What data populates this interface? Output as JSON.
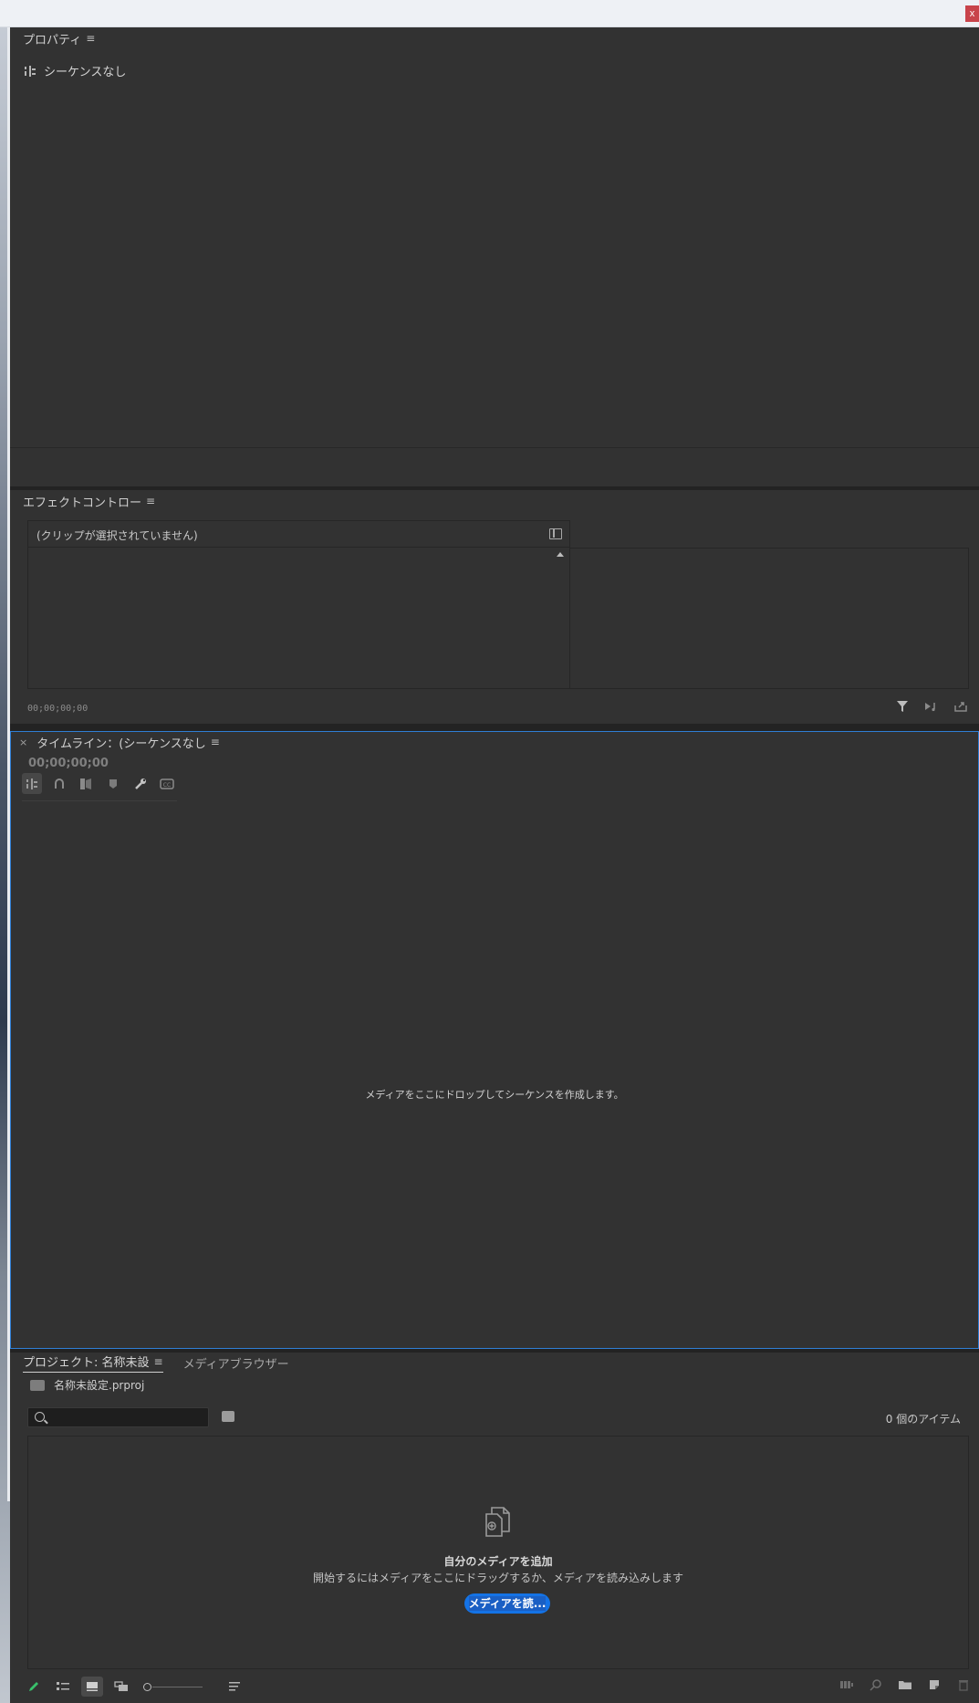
{
  "window": {
    "close_label": "x"
  },
  "properties": {
    "title": "プロパティ",
    "menu_glyph": "≡",
    "sequence_label": "シーケンスなし"
  },
  "effect_controls": {
    "title": "エフェクトコントロー",
    "menu_glyph": "≡",
    "clip_label": "(クリップが選択されていません)",
    "timecode": "00;00;00;00"
  },
  "timeline": {
    "close_glyph": "×",
    "title": "タイムライン：(シーケンスなし",
    "menu_glyph": "≡",
    "timecode": "00;00;00;00",
    "drop_message": "メディアをここにドロップしてシーケンスを作成します。"
  },
  "project": {
    "tab_project": "プロジェクト: 名称未設",
    "menu_glyph": "≡",
    "tab_media_browser": "メディアブラウザー",
    "project_file": "名称未設定.prproj",
    "search_placeholder": "",
    "item_count": "0 個のアイテム",
    "add_media_title": "自分のメディアを追加",
    "add_media_subtitle": "開始するにはメディアをここにドラッグするか、メディアを読み込みします",
    "import_button": "メディアを読..."
  },
  "colors": {
    "panel_bg": "#323232",
    "app_bg": "#232323",
    "accent_blue": "#1473e6",
    "focus_border": "#2f7ed4",
    "close_red": "#c8434a"
  }
}
